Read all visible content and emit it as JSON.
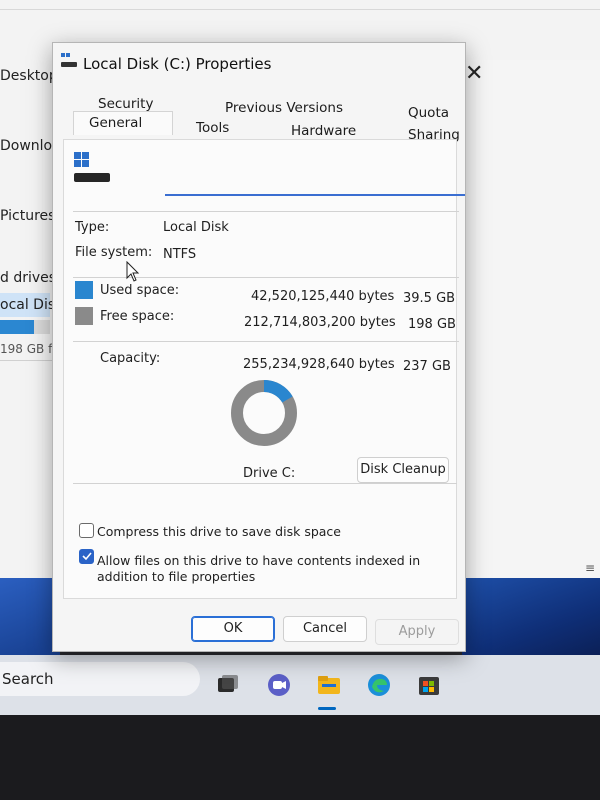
{
  "background": {
    "nav_items": [
      "Desktop",
      "Downloa",
      "Pictures"
    ],
    "section_label": "d drives",
    "selected_drive": "ocal Dis",
    "drive_free_text": "198 GB f",
    "taskbar_search": "Search"
  },
  "dialog": {
    "title": "Local Disk (C:) Properties",
    "close_glyph": "✕",
    "tabs_row1": [
      "Security",
      "Previous Versions",
      "Quota"
    ],
    "tabs_row2": [
      "General",
      "Tools",
      "Hardware",
      "Sharing"
    ],
    "active_tab": "General",
    "drive_name_value": "",
    "type_label": "Type:",
    "type_value": "Local Disk",
    "fs_label": "File system:",
    "fs_value": "NTFS",
    "used_label": "Used space:",
    "used_bytes": "42,520,125,440 bytes",
    "used_gb": "39.5 GB",
    "free_label": "Free space:",
    "free_bytes": "212,714,803,200 bytes",
    "free_gb": "198 GB",
    "capacity_label": "Capacity:",
    "capacity_bytes": "255,234,928,640 bytes",
    "capacity_gb": "237 GB",
    "drive_label": "Drive C:",
    "cleanup_button": "Disk Cleanup",
    "compress_label": "Compress this drive to save disk space",
    "compress_checked": false,
    "index_label": "Allow files on this drive to have contents indexed in addition to file properties",
    "index_checked": true,
    "ok_button": "OK",
    "cancel_button": "Cancel",
    "apply_button": "Apply",
    "used_fraction": 0.1666,
    "colors": {
      "used": "#2a86cf",
      "free": "#8a8a8a",
      "accent": "#2a6fd6"
    }
  },
  "taskbar_icons": [
    "task-view-icon",
    "chat-icon",
    "file-explorer-icon",
    "edge-icon",
    "store-icon"
  ]
}
